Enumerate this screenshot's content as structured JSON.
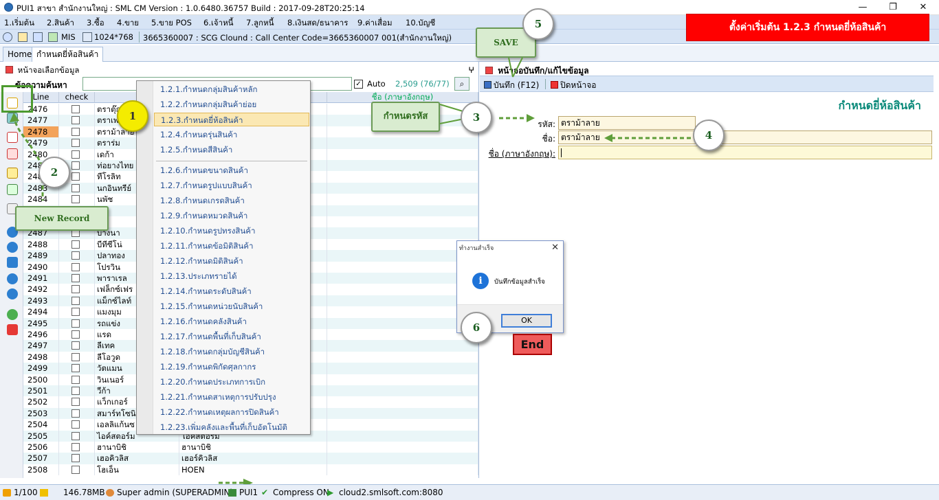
{
  "window": {
    "title": "PUI1 สาขา สำนักงานใหญ่ : SML CM Version : 1.0.6480.36757  Build : 2017-09-28T20:25:14",
    "minimize": "—",
    "maximize": "❐",
    "close": "✕"
  },
  "menu": [
    "1.เริ่มต้น",
    "2.สินค้า",
    "3.ซื้อ",
    "4.ขาย",
    "5.ขาย POS",
    "6.เจ้าหนี้",
    "7.ลูกหนี้",
    "8.เงินสด/ธนาคาร",
    "9.ค่าเสื่อม",
    "10.บัญชี"
  ],
  "toolbar": {
    "mis": "MIS",
    "resolution": "1024*768",
    "info": "3665360007 : SCG Clound : Call Center Code=3665360007 001(สำนักงานใหญ่)"
  },
  "banner": "ตั้งค่าเริ่มต้น 1.2.3 กำหนดยี่ห้อสินค้า",
  "tabs": [
    "Home",
    "กำหนดยี่ห้อสินค้า"
  ],
  "left": {
    "header": "หน้าจอเลือกข้อมูล",
    "pin": "ⵖ",
    "search_label": "ข้อความค้นหา",
    "auto_label": "Auto",
    "count": "2,509 (76/77)",
    "columns": {
      "line": "Line",
      "check": "check",
      "name": "ชื่อ (ภาษาอังกฤษ)"
    },
    "rows": [
      {
        "line": "2476",
        "name": "ตราตุ๊ก",
        "eng": ""
      },
      {
        "line": "2477",
        "name": "ตราเพ",
        "eng": ""
      },
      {
        "line": "2478",
        "name": "ตราม้าลาย",
        "eng": ""
      },
      {
        "line": "2479",
        "name": "ตราร่ม",
        "eng": ""
      },
      {
        "line": "2480",
        "name": "เดก้า",
        "eng": ""
      },
      {
        "line": "2481",
        "name": "ท่อยางไทย",
        "eng": ""
      },
      {
        "line": "2482",
        "name": "ทีโรลิท",
        "eng": ""
      },
      {
        "line": "2483",
        "name": "นกอินทรีย์",
        "eng": ""
      },
      {
        "line": "2484",
        "name": "นพัช",
        "eng": ""
      },
      {
        "line": "2485",
        "name": "",
        "eng": ""
      },
      {
        "line": "2486",
        "name": "",
        "eng": ""
      },
      {
        "line": "2487",
        "name": "บางนา",
        "eng": ""
      },
      {
        "line": "2488",
        "name": "บีทีซีโน่",
        "eng": ""
      },
      {
        "line": "2489",
        "name": "ปลาทอง",
        "eng": ""
      },
      {
        "line": "2490",
        "name": "โปรวิน",
        "eng": ""
      },
      {
        "line": "2491",
        "name": "พาราเรล",
        "eng": ""
      },
      {
        "line": "2492",
        "name": "เฟล็กซ์เฟร",
        "eng": ""
      },
      {
        "line": "2493",
        "name": "แม็กซ์ไลท์",
        "eng": ""
      },
      {
        "line": "2494",
        "name": "แมงมุม",
        "eng": ""
      },
      {
        "line": "2495",
        "name": "รถแข่ง",
        "eng": ""
      },
      {
        "line": "2496",
        "name": "แรด",
        "eng": ""
      },
      {
        "line": "2497",
        "name": "ลีเทค",
        "eng": ""
      },
      {
        "line": "2498",
        "name": "ลีโอวูด",
        "eng": ""
      },
      {
        "line": "2499",
        "name": "วัตแมน",
        "eng": ""
      },
      {
        "line": "2500",
        "name": "วินเนอร์",
        "eng": ""
      },
      {
        "line": "2501",
        "name": "วีก้า",
        "eng": ""
      },
      {
        "line": "2502",
        "name": "แว็กเกอร์",
        "eng": ""
      },
      {
        "line": "2503",
        "name": "สมาร์ทโซนิ",
        "eng": ""
      },
      {
        "line": "2504",
        "name": "เอลลิแก้นซ",
        "eng": ""
      },
      {
        "line": "2505",
        "name": "ไอค์สตอร์ม",
        "eng": "ไอค์สตอร์ม"
      },
      {
        "line": "2506",
        "name": "ฮานาบิชิ",
        "eng": "ฮานาบิชิ"
      },
      {
        "line": "2507",
        "name": "เฮอคิวลิส",
        "eng": "เฮอร์คิวลิส"
      },
      {
        "line": "2508",
        "name": "โฮเอ็น",
        "eng": "HOEN"
      }
    ]
  },
  "dropdown": [
    "1.2.1.กำหนดกลุ่มสินค้าหลัก",
    "1.2.2.กำหนดกลุ่มสินค้าย่อย",
    "1.2.3.กำหนดยี่ห้อสินค้า",
    "1.2.4.กำหนดรุ่นสินค้า",
    "1.2.5.กำหนดสีสินค้า",
    "1.2.6.กำหนดขนาดสินค้า",
    "1.2.7.กำหนดรูปแบบสินค้า",
    "1.2.8.กำหนดเกรดสินค้า",
    "1.2.9.กำหนดหมวดสินค้า",
    "1.2.10.กำหนดรูปทรงสินค้า",
    "1.2.11.กำหนดข้อมิติสินค้า",
    "1.2.12.กำหนดมิติสินค้า",
    "1.2.13.ประเภทรายได้",
    "1.2.14.กำหนดระดับสินค้า",
    "1.2.15.กำหนดหน่วยนับสินค้า",
    "1.2.16.กำหนดคลังสินค้า",
    "1.2.17.กำหนดพื้นที่เก็บสินค้า",
    "1.2.18.กำหนดกลุ่มบัญชีสินค้า",
    "1.2.19.กำหนดพิกัดศุลกากร",
    "1.2.20.กำหนดประเภทการเบิก",
    "1.2.21.กำหนดสาเหตุการปรับปรุง",
    "1.2.22.กำหนดเหตุผลการปิดสินค้า",
    "1.2.23.เพิ่มคลังและพื้นที่เก็บอัตโนมัติ"
  ],
  "right": {
    "header": "หน้าจอบันทึก/แก้ไขข้อมูล",
    "save_label": "บันทึก (F12)",
    "close_label": "ปิดหน้าจอ",
    "form_title": "กำหนดยี่ห้อสินค้า",
    "code_label": "รหัส:",
    "code_value": "ตราม้าลาย",
    "name_label": "ชื่อ:",
    "name_value": "ตราม้าลาย",
    "eng_label": "ชื่อ (ภาษาอังกฤษ):",
    "eng_value": ""
  },
  "dialog": {
    "title": "ทำงานสำเร็จ",
    "message": "บันทึกข้อมูลสำเร็จ",
    "ok": "OK",
    "info_symbol": "i",
    "close_symbol": "✕"
  },
  "end_label": "End",
  "annotations": {
    "n1": "1",
    "n2": "2",
    "n3": "3",
    "n4": "4",
    "n5": "5",
    "n6": "6",
    "save": "SAVE",
    "define_code": "กำหนดรหัส",
    "new_record": "New Record"
  },
  "status": {
    "page": "1/100",
    "memory": "146.78MB",
    "user": "Super admin (SUPERADMIN)",
    "db": "PUI1",
    "compress": "Compress ON",
    "server": "cloud2.smlsoft.com:8080"
  }
}
